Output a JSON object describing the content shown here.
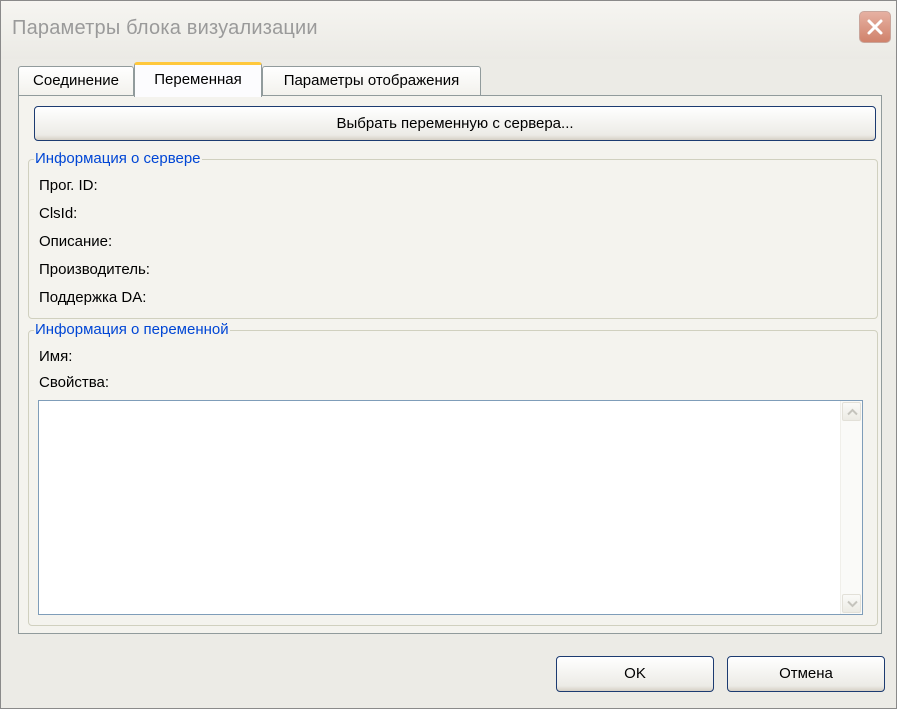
{
  "window": {
    "title": "Параметры блока визуализации"
  },
  "tabs": [
    {
      "label": "Соединение",
      "active": false
    },
    {
      "label": "Переменная",
      "active": true
    },
    {
      "label": "Параметры отображения",
      "active": false
    }
  ],
  "variable_tab": {
    "select_button_label": "Выбрать переменную с сервера...",
    "server_info": {
      "legend": "Информация о сервере",
      "fields": [
        {
          "label": "Прог. ID:"
        },
        {
          "label": "ClsId:"
        },
        {
          "label": "Описание:"
        },
        {
          "label": "Производитель:"
        },
        {
          "label": "Поддержка DA:"
        }
      ]
    },
    "variable_info": {
      "legend": "Информация о переменной",
      "name_label": "Имя:",
      "properties_label": "Свойства:",
      "properties_value": ""
    }
  },
  "footer": {
    "ok_label": "OK",
    "cancel_label": "Отмена"
  },
  "colors": {
    "group_legend": "#0046d5",
    "active_tab_accent": "#ffc83c",
    "close_button": "#d0826b"
  },
  "icons": {
    "close": "close-icon",
    "scroll_up": "chevron-up-icon",
    "scroll_down": "chevron-down-icon"
  }
}
